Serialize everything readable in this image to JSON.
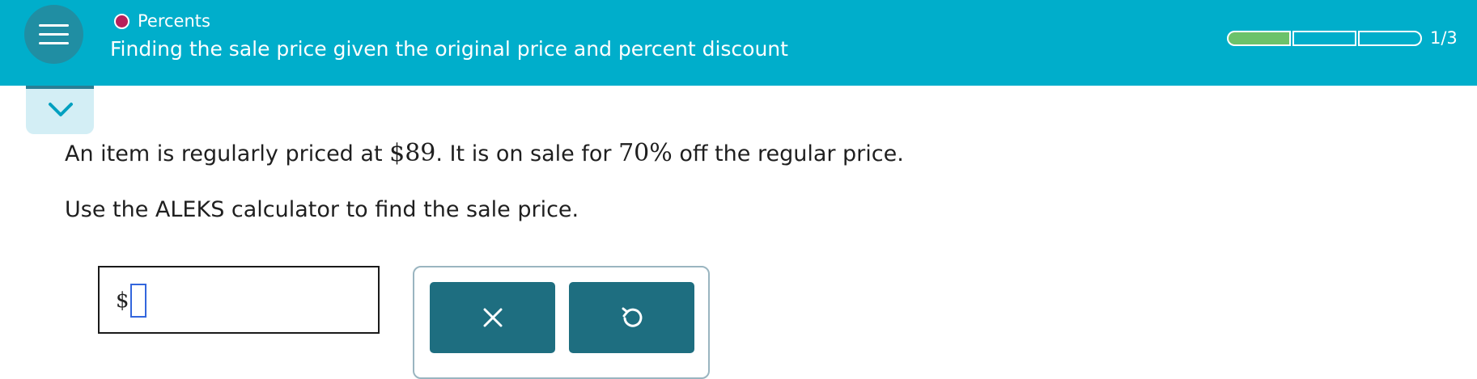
{
  "header": {
    "topic": "Percents",
    "title": "Finding the sale price given the original price and percent discount",
    "progress": {
      "filled_segments": 1,
      "total_segments": 3,
      "label": "1/3"
    },
    "colors": {
      "bar": "#00aecb",
      "topic_dot": "#b8205a",
      "progress_fill": "#6cc26a"
    }
  },
  "icons": {
    "menu": "hamburger-icon",
    "collapse": "chevron-down-icon",
    "clear": "x-icon",
    "undo": "undo-icon"
  },
  "question": {
    "part1": "An item is regularly priced at ",
    "price": "$89",
    "part2": ". It is on sale for ",
    "percent": "70%",
    "part3": " off the regular price."
  },
  "instruction": "Use the ALEKS calculator to find the sale price.",
  "answer": {
    "prefix": "$",
    "value": ""
  }
}
